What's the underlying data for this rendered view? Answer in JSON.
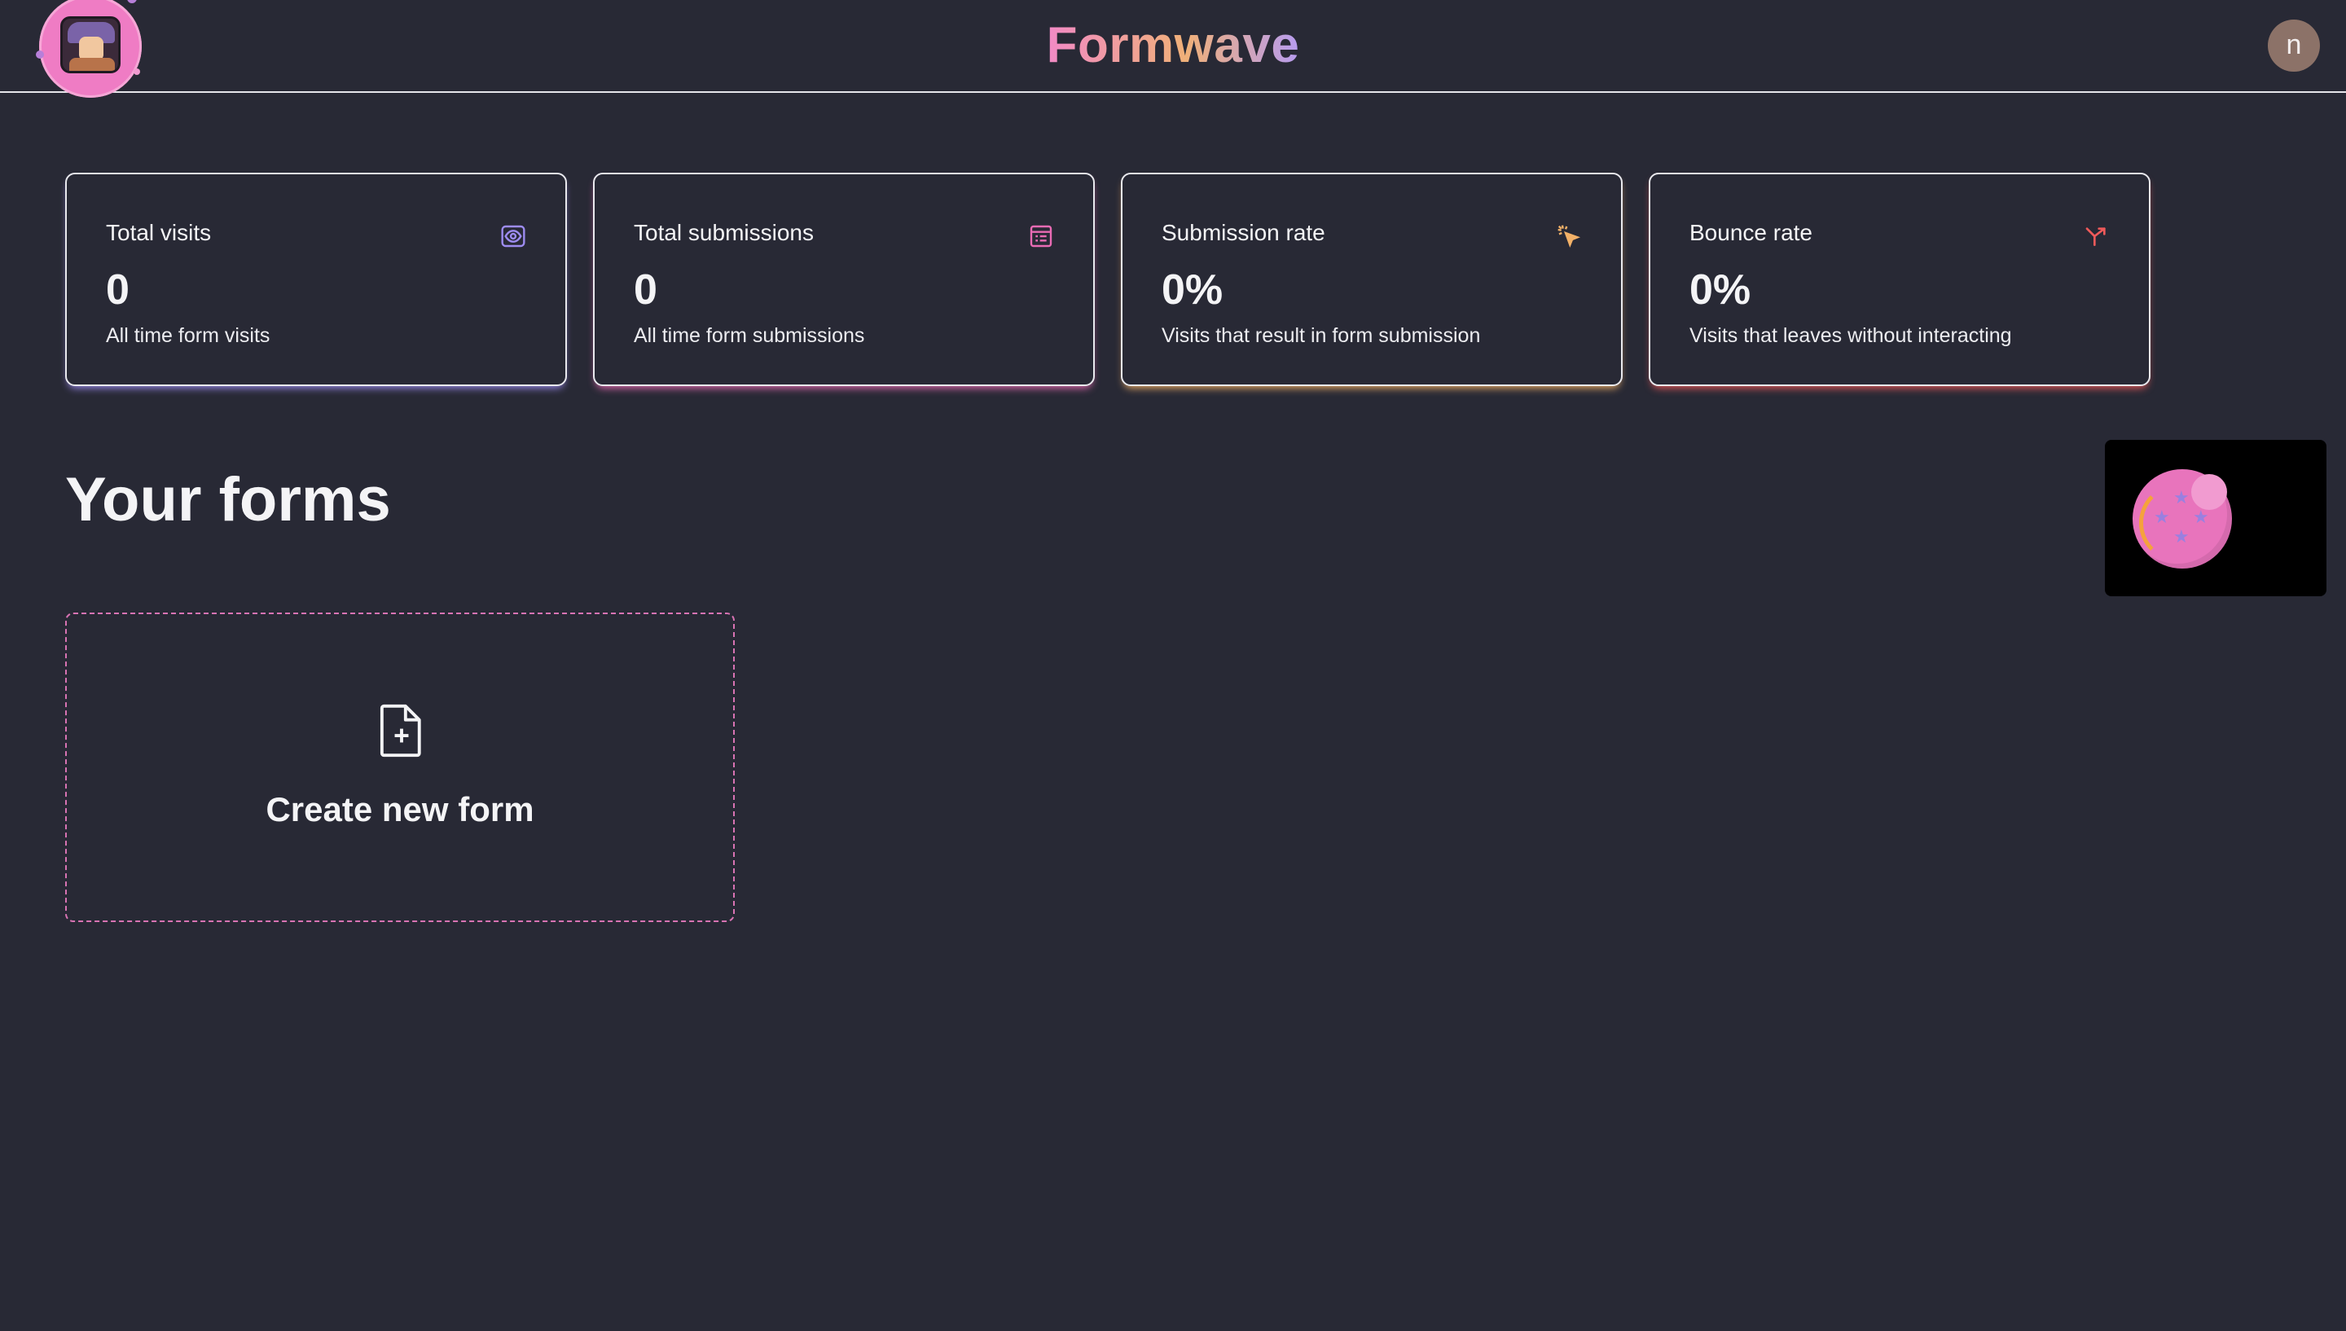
{
  "header": {
    "brand": "Formwave",
    "avatar_initial": "n"
  },
  "stats": [
    {
      "title": "Total visits",
      "value": "0",
      "description": "All time form visits",
      "icon": "eye-icon",
      "accent": "#9d8cf0"
    },
    {
      "title": "Total submissions",
      "value": "0",
      "description": "All time form submissions",
      "icon": "form-list-icon",
      "accent": "#e96bb4"
    },
    {
      "title": "Submission rate",
      "value": "0%",
      "description": "Visits that result in form submission",
      "icon": "cursor-click-icon",
      "accent": "#f3b168"
    },
    {
      "title": "Bounce rate",
      "value": "0%",
      "description": "Visits that leaves without interacting",
      "icon": "split-arrow-icon",
      "accent": "#ef5a5a"
    }
  ],
  "forms": {
    "heading": "Your forms",
    "create_label": "Create new form"
  },
  "colors": {
    "background": "#282935",
    "brand_gradient": [
      "#f18ac6",
      "#f0b078",
      "#b79cf0"
    ],
    "create_border": "#d873b3"
  }
}
